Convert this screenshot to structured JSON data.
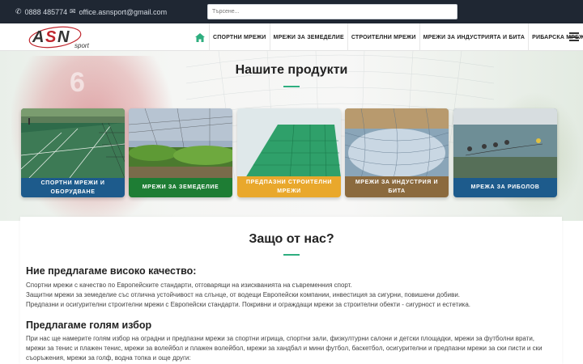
{
  "topbar": {
    "phone": "0888 485774",
    "email": "office.asnsport@gmail.com",
    "phone_icon": "phone-icon",
    "email_icon": "envelope-icon",
    "search_placeholder": "Търсене..."
  },
  "logo": {
    "text_a": "A",
    "text_s": "S",
    "text_n": "N",
    "text_sport": "sport"
  },
  "nav": {
    "home_icon": "home-icon",
    "items": [
      "СПОРТНИ МРЕЖИ",
      "МРЕЖИ ЗА ЗЕМЕДЕЛИЕ",
      "СТРОИТЕЛНИ МРЕЖИ",
      "МРЕЖИ ЗА ИНДУСТРИЯТА И БИТА",
      "РИБАРСКА МРЕЖА"
    ],
    "menu_icon": "hamburger-icon"
  },
  "hero": {
    "jersey_number": "6"
  },
  "products": {
    "title": "Нашите продукти",
    "cards": [
      {
        "label": "СПОРТНИ МРЕЖИ И ОБОРУДВАНЕ",
        "color": "#1d5b8c"
      },
      {
        "label": "МРЕЖИ ЗА ЗЕМЕДЕЛИЕ",
        "color": "#1e7d34"
      },
      {
        "label": "ПРЕДПАЗНИ СТРОИТЕЛНИ МРЕЖИ",
        "color": "#e9a82c"
      },
      {
        "label": "МРЕЖИ ЗА ИНДУСТРИЯ И БИТА",
        "color": "#8b6a3e"
      },
      {
        "label": "МРЕЖА ЗА РИБОЛОВ",
        "color": "#1d5b8c"
      }
    ]
  },
  "why": {
    "title": "Защо от нас?",
    "heading1": "Ние предлагаме високо качество:",
    "para1": [
      "Спортни мрежи с качество по Европейските стандарти, отговарящи на изискванията на съвременния спорт.",
      "Защитни мрежи за земеделие със отлична устойчивост на слънце, от водещи Европейски компании, инвестиция за сигурни, повишени добиви.",
      "Предпазни и осигурителни строителни мрежи с Европейски стандарти. Покривни и ограждащи мрежи за строителни обекти - сигурност и естетика."
    ],
    "heading2": "Предлагаме голям избор",
    "para2": [
      "При нас ще намерите голям избор на оградни и предпазни мрежи за спортни игрища, спортни зали, физкултурни салони и детски площадки, мрежи за футболни врати,",
      "мрежи за тенис и плажен тенис, мрежи за волейбол и плажен волейбол, мрежи за хандбал и мини футбол, баскетбол, осигурителни и предпазни мрежи за ски писти и ски",
      "съоръжения, мрежи за голф, водна топка и още други:"
    ]
  },
  "colors": {
    "accent": "#2eae7f",
    "topbar": "#1f2733"
  }
}
